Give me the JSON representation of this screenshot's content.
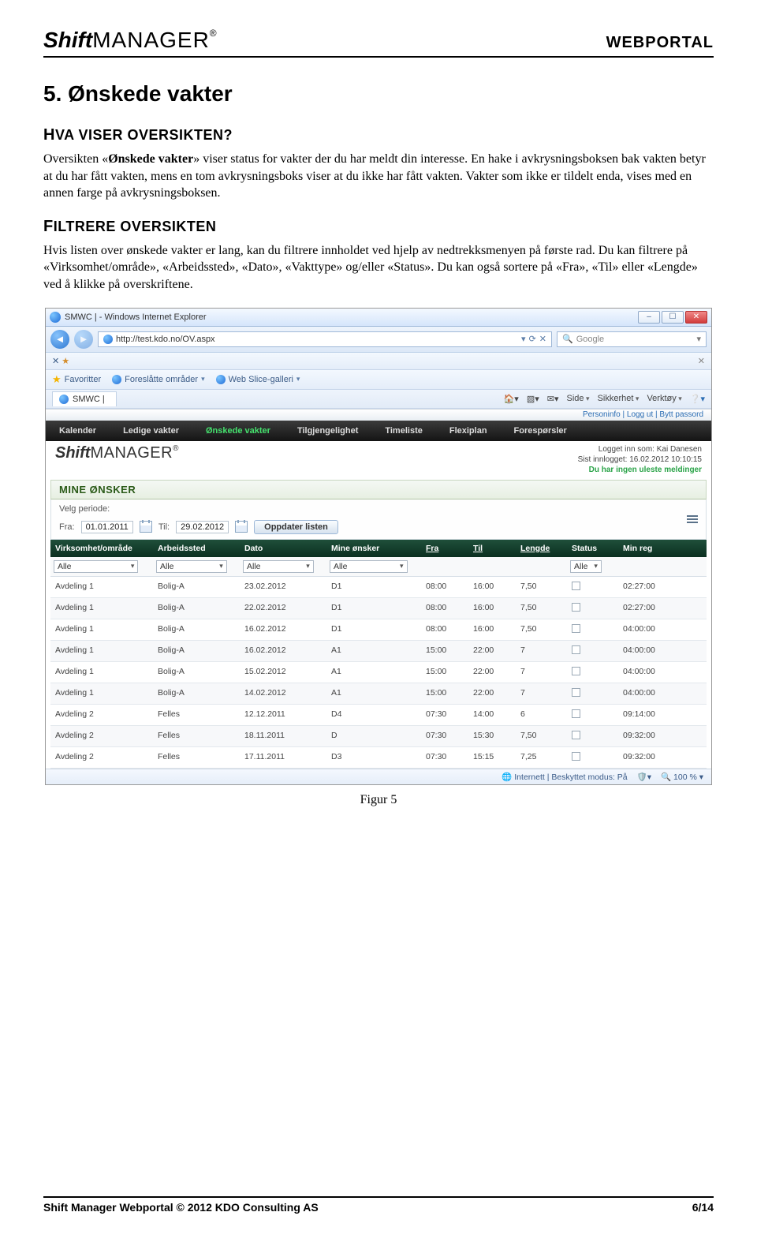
{
  "doc": {
    "logo_bold": "Shift",
    "logo_thin": "MANAGER",
    "logo_reg": "®",
    "header_right": "WEBPORTAL",
    "section_title": "5. Ønskede vakter",
    "h_hva_F": "H",
    "h_hva_rest": "VA VISER OVERSIKTEN?",
    "para1a": "Oversikten «",
    "para1b": "Ønskede vakter",
    "para1c": "» viser status for vakter der du har meldt din interesse. En hake i avkrysningsboksen bak vakten betyr at du har fått vakten, mens en tom avkrysningsboks viser at du ikke har fått vakten. Vakter som ikke er tildelt enda, vises med en annen farge på avkrysningsboksen.",
    "h_filt_F": "F",
    "h_filt_rest": "ILTRERE OVERSIKTEN",
    "para2": "Hvis listen over ønskede vakter er lang, kan du filtrere innholdet ved hjelp av nedtrekksmenyen på første rad. Du kan filtrere på «Virksomhet/område», «Arbeidssted», «Dato», «Vakttype» og/eller «Status». Du kan også sortere på «Fra», «Til» eller «Lengde» ved å klikke på overskriftene.",
    "figcap": "Figur 5",
    "footer_left": "Shift Manager Webportal © 2012 KDO Consulting AS",
    "footer_right": "6/14"
  },
  "ie": {
    "title": "SMWC | - Windows Internet Explorer",
    "url": "http://test.kdo.no/OV.aspx",
    "search_placeholder": "Google",
    "fav": "Favoritter",
    "tb_item1": "Foreslåtte områder",
    "tb_item2": "Web Slice-galleri",
    "tab_label": "SMWC |",
    "right_items": [
      "Side",
      "Sikkerhet",
      "Verktøy"
    ],
    "status_left": "Internett | Beskyttet modus: På",
    "zoom": "100 %"
  },
  "portal": {
    "top_links": "Personinfo | Logg ut | Bytt passord",
    "menu": [
      "Kalender",
      "Ledige vakter",
      "Ønskede vakter",
      "Tilgjengelighet",
      "Timeliste",
      "Flexiplan",
      "Forespørsler"
    ],
    "menu_active_index": 2,
    "sm_logo_b": "Shift",
    "sm_logo_t": "MANAGER",
    "sm_logo_reg": "®",
    "login_line1": "Logget inn som: Kai Danesen",
    "login_line2": "Sist innlogget: 16.02.2012 10:10:15",
    "login_msg": "Du har ingen uleste meldinger",
    "panel_title": "MINE ØNSKER",
    "period_label": "Velg periode:",
    "fra_lbl": "Fra:",
    "fra_val": "01.01.2011",
    "til_lbl": "Til:",
    "til_val": "29.02.2012",
    "update_btn": "Oppdater listen"
  },
  "table": {
    "headers": [
      "Virksomhet/område",
      "Arbeidssted",
      "Dato",
      "Mine ønsker",
      "Fra",
      "Til",
      "Lengde",
      "Status",
      "Min reg"
    ],
    "sortable_underline": [
      false,
      false,
      false,
      false,
      true,
      true,
      true,
      false,
      false
    ],
    "filters": [
      "Alle",
      "Alle",
      "Alle",
      "Alle",
      "",
      "",
      "",
      "Alle",
      ""
    ],
    "rows": [
      {
        "v": "Avdeling 1",
        "a": "Bolig-A",
        "d": "23.02.2012",
        "m": "D1",
        "fra": "08:00",
        "til": "16:00",
        "len": "7,50",
        "reg": "02:27:00"
      },
      {
        "v": "Avdeling 1",
        "a": "Bolig-A",
        "d": "22.02.2012",
        "m": "D1",
        "fra": "08:00",
        "til": "16:00",
        "len": "7,50",
        "reg": "02:27:00"
      },
      {
        "v": "Avdeling 1",
        "a": "Bolig-A",
        "d": "16.02.2012",
        "m": "D1",
        "fra": "08:00",
        "til": "16:00",
        "len": "7,50",
        "reg": "04:00:00"
      },
      {
        "v": "Avdeling 1",
        "a": "Bolig-A",
        "d": "16.02.2012",
        "m": "A1",
        "fra": "15:00",
        "til": "22:00",
        "len": "7",
        "reg": "04:00:00"
      },
      {
        "v": "Avdeling 1",
        "a": "Bolig-A",
        "d": "15.02.2012",
        "m": "A1",
        "fra": "15:00",
        "til": "22:00",
        "len": "7",
        "reg": "04:00:00"
      },
      {
        "v": "Avdeling 1",
        "a": "Bolig-A",
        "d": "14.02.2012",
        "m": "A1",
        "fra": "15:00",
        "til": "22:00",
        "len": "7",
        "reg": "04:00:00"
      },
      {
        "v": "Avdeling 2",
        "a": "Felles",
        "d": "12.12.2011",
        "m": "D4",
        "fra": "07:30",
        "til": "14:00",
        "len": "6",
        "reg": "09:14:00"
      },
      {
        "v": "Avdeling 2",
        "a": "Felles",
        "d": "18.11.2011",
        "m": "D",
        "fra": "07:30",
        "til": "15:30",
        "len": "7,50",
        "reg": "09:32:00"
      },
      {
        "v": "Avdeling 2",
        "a": "Felles",
        "d": "17.11.2011",
        "m": "D3",
        "fra": "07:30",
        "til": "15:15",
        "len": "7,25",
        "reg": "09:32:00"
      }
    ]
  }
}
